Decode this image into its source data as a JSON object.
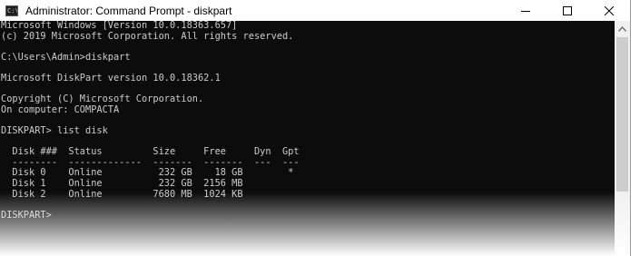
{
  "window": {
    "title": "Administrator: Command Prompt - diskpart",
    "app_icon_text": "C:\\"
  },
  "icons": {
    "minimize": "minimize-icon",
    "maximize": "maximize-icon",
    "close": "close-icon",
    "scroll_up": "chevron-up-icon"
  },
  "console": {
    "lines": [
      "Microsoft Windows [Version 10.0.18363.657]",
      "(c) 2019 Microsoft Corporation. All rights reserved.",
      "",
      "C:\\Users\\Admin>diskpart",
      "",
      "Microsoft DiskPart version 10.0.18362.1",
      "",
      "Copyright (C) Microsoft Corporation.",
      "On computer: COMPACTA",
      "",
      "DISKPART> list disk",
      "",
      "  Disk ###  Status         Size     Free     Dyn  Gpt",
      "  --------  -------------  -------  -------  ---  ---",
      "  Disk 0    Online          232 GB    18 GB        *",
      "  Disk 1    Online          232 GB  2156 MB",
      "  Disk 2    Online         7680 MB  1024 KB",
      "",
      "DISKPART>"
    ]
  },
  "colors": {
    "console_bg": "#0c0c0c",
    "console_text": "#cccccc",
    "titlebar_bg": "#ffffff"
  }
}
